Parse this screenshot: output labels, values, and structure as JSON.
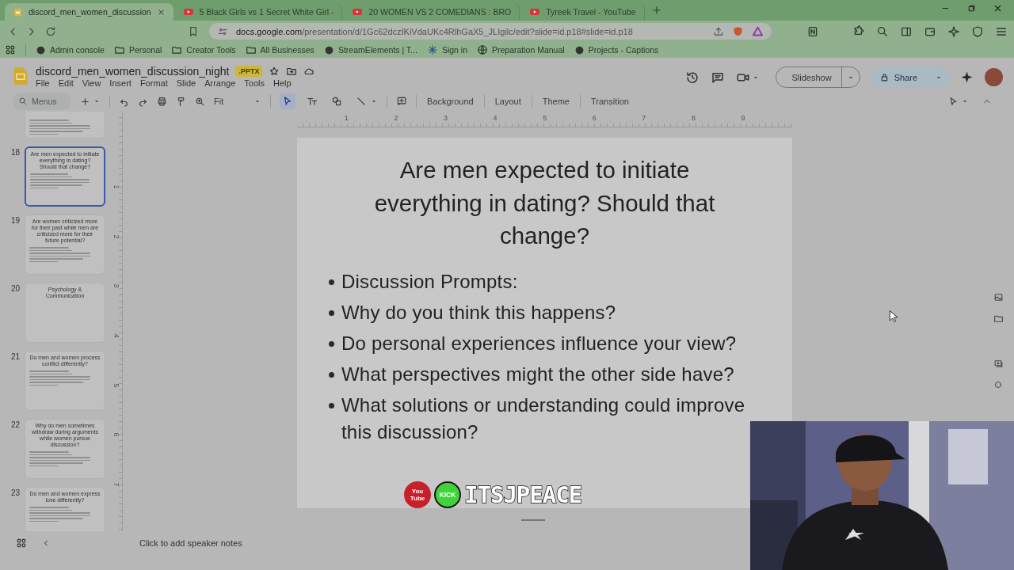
{
  "browser": {
    "tabs": [
      {
        "title": "discord_men_women_discussion",
        "kind": "slides",
        "selected": true
      },
      {
        "title": "5 Black Girls vs 1 Secret White Girl -",
        "kind": "video",
        "selected": false
      },
      {
        "title": "20 WOMEN VS 2 COMEDIANS : BRO",
        "kind": "video",
        "selected": false
      },
      {
        "title": "Tyreek Travel - YouTube",
        "kind": "video",
        "selected": false
      }
    ],
    "address": {
      "host": "docs.google.com",
      "path": "/presentation/d/1Gc62dczIKiVdaUKc4RlhGaX5_JLIgilc/edit?slide=id.p18#slide=id.p18"
    },
    "bookmarks": [
      {
        "label": "Admin console",
        "kind": "site"
      },
      {
        "label": "Personal",
        "kind": "folder"
      },
      {
        "label": "Creator Tools",
        "kind": "folder"
      },
      {
        "label": "All Businesses",
        "kind": "folder"
      },
      {
        "label": "StreamElements | T...",
        "kind": "site"
      },
      {
        "label": "Sign in",
        "kind": "spark"
      },
      {
        "label": "Preparation Manual",
        "kind": "globe"
      },
      {
        "label": "Projects - Captions",
        "kind": "site"
      }
    ]
  },
  "document": {
    "title": "discord_men_women_discussion_night",
    "badge": ".PPTX"
  },
  "menu": [
    "File",
    "Edit",
    "View",
    "Insert",
    "Format",
    "Slide",
    "Arrange",
    "Tools",
    "Help"
  ],
  "actions": {
    "slideshow": "Slideshow",
    "share": "Share"
  },
  "toolbar": {
    "search_placeholder": "Menus",
    "zoom": "Fit",
    "tools": [
      {
        "kind": "select",
        "selected": true
      },
      {
        "kind": "text",
        "selected": false
      },
      {
        "kind": "shape",
        "selected": false
      },
      {
        "kind": "line",
        "selected": false
      }
    ],
    "buttons": [
      "Background",
      "Layout",
      "Theme",
      "Transition"
    ]
  },
  "filmstrip": [
    {
      "kind": "prompts",
      "selected": false
    },
    {
      "number": "18",
      "title": "Are men expected to initiate everything in dating? Should that change?",
      "kind": "prompts",
      "selected": true
    },
    {
      "number": "19",
      "title": "Are women criticized more for their past while men are criticized more for their future potential?",
      "kind": "prompts",
      "selected": false
    },
    {
      "number": "20",
      "title": "Psychology & Communication",
      "kind": "section",
      "selected": false
    },
    {
      "number": "21",
      "title": "Do men and women process conflict differently?",
      "kind": "prompts",
      "selected": false
    },
    {
      "number": "22",
      "title": "Why do men sometimes withdraw during arguments while women pursue discussion?",
      "kind": "prompts",
      "selected": false
    },
    {
      "number": "23",
      "title": "Do men and women express love differently?",
      "kind": "prompts",
      "selected": false
    }
  ],
  "rulers": {
    "horizontal": [
      "1",
      "2",
      "3",
      "4",
      "5",
      "6",
      "7",
      "8",
      "9"
    ],
    "vertical": [
      "1",
      "2",
      "3",
      "4",
      "5",
      "6",
      "7"
    ]
  },
  "slide": {
    "title": "Are men expected to initiate everything in dating? Should that change?",
    "bullets": [
      "Discussion Prompts:",
      "Why do you think this happens?",
      "Do personal experiences influence your view?",
      "What perspectives might the other side have?",
      "What solutions or understanding could improve this discussion?"
    ]
  },
  "stream_overlay": {
    "youtube_label": "You Tube",
    "kick_label": "KICK",
    "handle": "ITSJPEACE"
  },
  "speaker_notes": {
    "placeholder": "Click to add speaker notes"
  }
}
